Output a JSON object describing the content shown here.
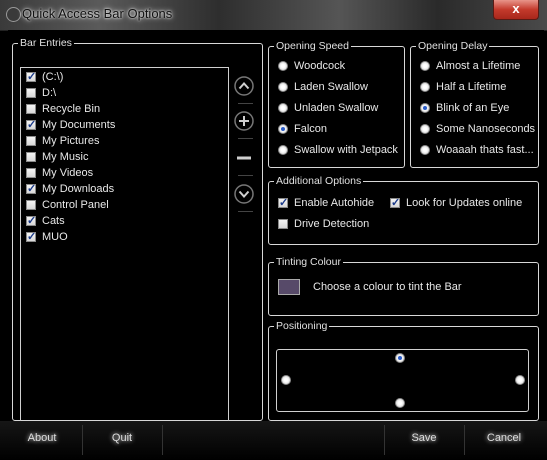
{
  "window": {
    "title": "Quick Access Bar Options",
    "close_label": "x"
  },
  "bar_entries": {
    "legend": "Bar Entries",
    "items": [
      {
        "label": "(C:\\)",
        "checked": true
      },
      {
        "label": "D:\\",
        "checked": false
      },
      {
        "label": "Recycle Bin",
        "checked": false
      },
      {
        "label": "My Documents",
        "checked": true
      },
      {
        "label": "My Pictures",
        "checked": false
      },
      {
        "label": "My Music",
        "checked": false
      },
      {
        "label": "My Videos",
        "checked": false
      },
      {
        "label": "My Downloads",
        "checked": true
      },
      {
        "label": "Control Panel",
        "checked": false
      },
      {
        "label": "Cats",
        "checked": true
      },
      {
        "label": "MUO",
        "checked": true
      }
    ],
    "buttons": {
      "up": "^",
      "add": "+",
      "remove": "-",
      "down": "v"
    }
  },
  "opening_speed": {
    "legend": "Opening Speed",
    "options": [
      "Woodcock",
      "Laden Swallow",
      "Unladen Swallow",
      "Falcon",
      "Swallow with Jetpack"
    ],
    "selected": "Falcon"
  },
  "opening_delay": {
    "legend": "Opening Delay",
    "options": [
      "Almost a Lifetime",
      "Half a Lifetime",
      "Blink of an Eye",
      "Some Nanoseconds",
      "Woaaah thats fast..."
    ],
    "selected": "Blink of an Eye"
  },
  "additional_options": {
    "legend": "Additional Options",
    "enable_autohide": {
      "label": "Enable Autohide",
      "checked": true
    },
    "look_for_updates": {
      "label": "Look for Updates online",
      "checked": true
    },
    "drive_detection": {
      "label": "Drive Detection",
      "checked": false
    }
  },
  "tinting": {
    "legend": "Tinting Colour",
    "label": "Choose a colour to tint the Bar",
    "color": "#574a69"
  },
  "positioning": {
    "legend": "Positioning",
    "selected": "top"
  },
  "footer": {
    "about": "About",
    "quit": "Quit",
    "save": "Save",
    "cancel": "Cancel"
  }
}
